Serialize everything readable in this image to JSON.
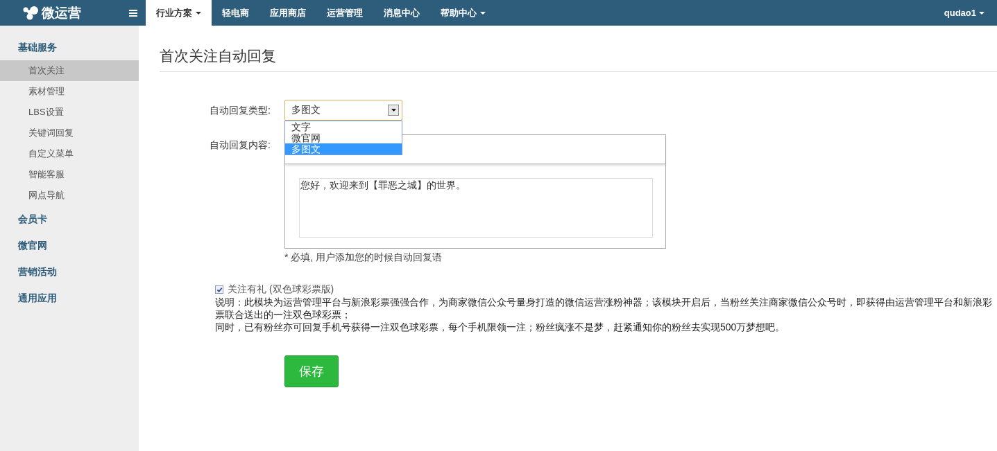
{
  "topbar": {
    "logo": "微运营",
    "nav": [
      {
        "label": "行业方案",
        "selected": true,
        "dropdown": true
      },
      {
        "label": "轻电商",
        "selected": false,
        "dropdown": false
      },
      {
        "label": "应用商店",
        "selected": false,
        "dropdown": false
      },
      {
        "label": "运营管理",
        "selected": false,
        "dropdown": false
      },
      {
        "label": "消息中心",
        "selected": false,
        "dropdown": false
      },
      {
        "label": "帮助中心",
        "selected": false,
        "dropdown": true
      }
    ],
    "user": "qudao1"
  },
  "sidebar": {
    "groups": [
      {
        "label": "基础服务",
        "items": [
          {
            "label": "首次关注",
            "selected": true
          },
          {
            "label": "素材管理",
            "selected": false
          },
          {
            "label": "LBS设置",
            "selected": false
          },
          {
            "label": "关键词回复",
            "selected": false
          },
          {
            "label": "自定义菜单",
            "selected": false
          },
          {
            "label": "智能客服",
            "selected": false
          },
          {
            "label": "网点导航",
            "selected": false
          }
        ]
      },
      {
        "label": "会员卡"
      },
      {
        "label": "微官网"
      },
      {
        "label": "营销活动"
      },
      {
        "label": "通用应用"
      }
    ]
  },
  "page_title": "首次关注自动回复",
  "form": {
    "type_label": "自动回复类型:",
    "type_value": "多图文",
    "type_options": [
      {
        "label": "文字",
        "selected": false
      },
      {
        "label": "微官网",
        "selected": false
      },
      {
        "label": "多图文",
        "selected": true
      }
    ],
    "content_label": "自动回复内容:",
    "content_value": "您好，欢迎来到【罪恶之城】的世界。",
    "help": "* 必填, 用户添加您的时候自动回复语",
    "gift": {
      "label": "关注有礼 (双色球彩票版)",
      "checked": true
    },
    "description": [
      "说明：此模块为运营管理平台与新浪彩票强强合作，为商家微信公众号量身打造的微信运营涨粉神器；该模块开启后，当粉丝关注商家微信公众号时，即获得由运营管理平台和新浪彩票联合送出的一注双色球彩票；",
      "同时，已有粉丝亦可回复手机号获得一注双色球彩票，每个手机限领一注；粉丝疯涨不是梦，赶紧通知你的粉丝去实现500万梦想吧。"
    ],
    "save": "保存"
  }
}
